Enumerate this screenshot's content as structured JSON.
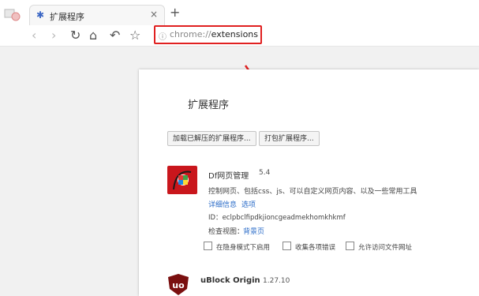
{
  "browser": {
    "tab": {
      "title": "扩展程序",
      "close": "×"
    },
    "new_tab": "+",
    "nav": {
      "back": "‹",
      "forward": "›",
      "reload": "↻",
      "home": "⌂",
      "undo": "↶",
      "bookmark": "☆"
    },
    "address": {
      "scheme": "chrome://",
      "path": "extensions",
      "icon": "ⓘ"
    }
  },
  "page": {
    "title": "扩展程序",
    "load_unpacked": "加载已解压的扩展程序...",
    "pack_extension": "打包扩展程序..."
  },
  "extensions": [
    {
      "name": "Df网页管理",
      "version": "5.4",
      "description": "控制网页、包括css、js、可以自定义网页内容、以及一些常用工具",
      "details_link": "详细信息",
      "options_link": "选项",
      "id_label": "ID：",
      "id": "eclpbclfipdkjioncgeadmekhomkhkmf",
      "inspect_label": "检查视图：",
      "inspect_link": "背景页",
      "options": [
        "在隐身模式下启用",
        "收集各项错误",
        "允许访问文件网址"
      ],
      "icon": "df-icon"
    },
    {
      "name": "uBlock Origin",
      "version": "1.27.10",
      "icon": "ublock-icon"
    }
  ],
  "colors": {
    "highlight": "#e02020",
    "link": "#2b6cc8",
    "df_icon": "#c9161c",
    "ublock": "#7a0f0f"
  }
}
